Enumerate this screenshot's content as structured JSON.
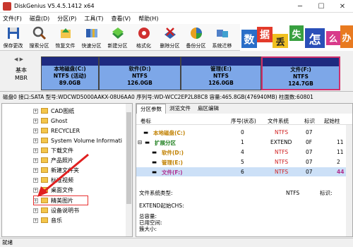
{
  "window": {
    "title": "DiskGenius V5.4.5.1412 x64"
  },
  "menu": [
    "文件(F)",
    "磁盘(D)",
    "分区(P)",
    "工具(T)",
    "查看(V)",
    "帮助(H)"
  ],
  "toolbar": [
    {
      "label": "保存更改",
      "icon": "save-icon"
    },
    {
      "label": "搜索分区",
      "icon": "search-icon"
    },
    {
      "label": "恢复文件",
      "icon": "recover-icon"
    },
    {
      "label": "快速分区",
      "icon": "quick-partition-icon"
    },
    {
      "label": "新建分区",
      "icon": "new-partition-icon"
    },
    {
      "label": "格式化",
      "icon": "format-icon"
    },
    {
      "label": "删除分区",
      "icon": "delete-partition-icon"
    },
    {
      "label": "备份分区",
      "icon": "backup-icon"
    },
    {
      "label": "系统迁移",
      "icon": "migrate-icon"
    }
  ],
  "ad": {
    "chars": [
      "数",
      "据",
      "丢",
      "失",
      "怎",
      "么",
      "办"
    ]
  },
  "disk": {
    "type_line1": "基本",
    "type_line2": "MBR"
  },
  "partitions": [
    {
      "name": "本地磁盘(C:)",
      "fs": "NTFS (活动)",
      "size": "89.0GB"
    },
    {
      "name": "软件(D:)",
      "fs": "NTFS",
      "size": "126.0GB"
    },
    {
      "name": "管理(E:)",
      "fs": "NTFS",
      "size": "126.0GB"
    },
    {
      "name": "文件(F:)",
      "fs": "NTFS",
      "size": "124.7GB"
    }
  ],
  "disk_info": "磁盘0 接口:SATA  型号:WDCWD5000AAKX-08U6AA0  序列号:WD-WCC2EP2L88C8  容量:465.8GB(476940MB)  柱面数:60801",
  "tree": [
    "CAD图纸",
    "Ghost",
    "RECYCLER",
    "System Volume Informati",
    "下载文件",
    "产品照片",
    "新建文件夹",
    "标准视频",
    "桌面文件",
    "精美图片",
    "设备说明书",
    "音乐"
  ],
  "tabs": [
    "分区参数",
    "浏览文件",
    "扇区编辑"
  ],
  "table": {
    "headers": [
      "卷标",
      "序号(状态)",
      "文件系统",
      "标识",
      "起始柱"
    ],
    "rows": [
      {
        "label": "本地磁盘(C:)",
        "seq": "0",
        "fs": "NTFS",
        "id": "07",
        "start": ""
      },
      {
        "label": "扩展分区",
        "seq": "1",
        "fs": "EXTEND",
        "id": "0F",
        "start": "11"
      },
      {
        "label": "软件(D:)",
        "seq": "4",
        "fs": "NTFS",
        "id": "07",
        "start": "11"
      },
      {
        "label": "管理(E:)",
        "seq": "5",
        "fs": "NTFS",
        "id": "07",
        "start": "2"
      },
      {
        "label": "文件(F:)",
        "seq": "6",
        "fs": "NTFS",
        "id": "07",
        "start": "44"
      }
    ]
  },
  "details": {
    "fs_type_label": "文件系统类型:",
    "fs_type_value": "NTFS",
    "fs_id_label": "标识:",
    "extend_label": "EXTEND起始CHS:",
    "total_label": "总容量:",
    "used_label": "已用空间:",
    "cluster_label": "簇大小:"
  },
  "status": "就绪"
}
